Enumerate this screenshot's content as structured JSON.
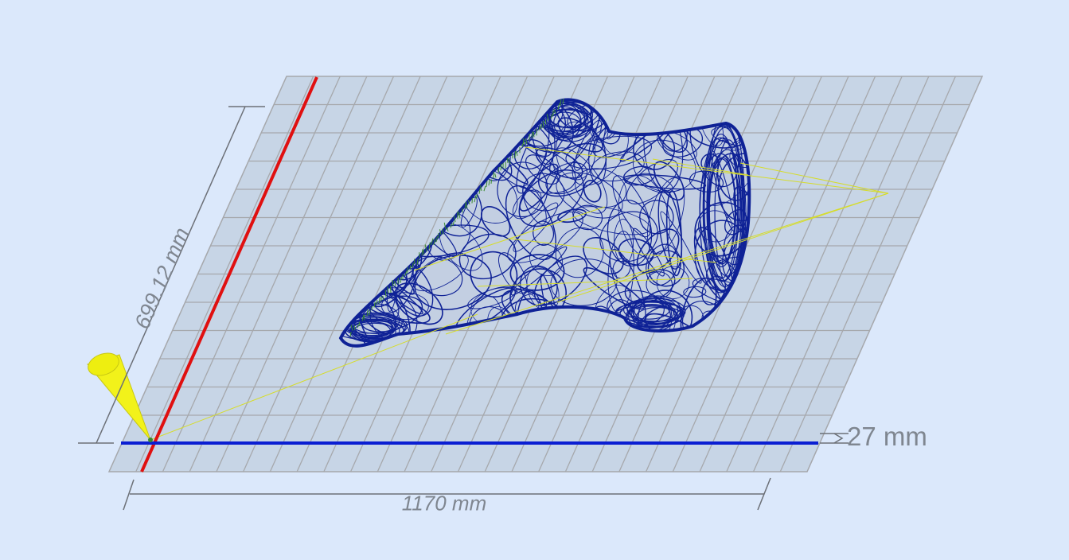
{
  "viewport": {
    "dimensions": {
      "width_label": "1170 mm",
      "depth_label": "699.12 mm",
      "height_label": "27 mm"
    },
    "axes": {
      "x_color": "#0a1ed2",
      "y_color": "#e01010"
    },
    "build_plate": {
      "fill_color": "#c7d5e6",
      "grid_color": "#a6a8ac",
      "grid_columns": 26,
      "grid_rows": 14
    },
    "model": {
      "wire_color": "#0f2296",
      "travel_color": "#d6dc2a",
      "support_color": "#3a8a30"
    },
    "camera_marker": {
      "icon": "cone-icon",
      "color": "#f2f21a"
    },
    "background_color": "#dbe8fb"
  }
}
